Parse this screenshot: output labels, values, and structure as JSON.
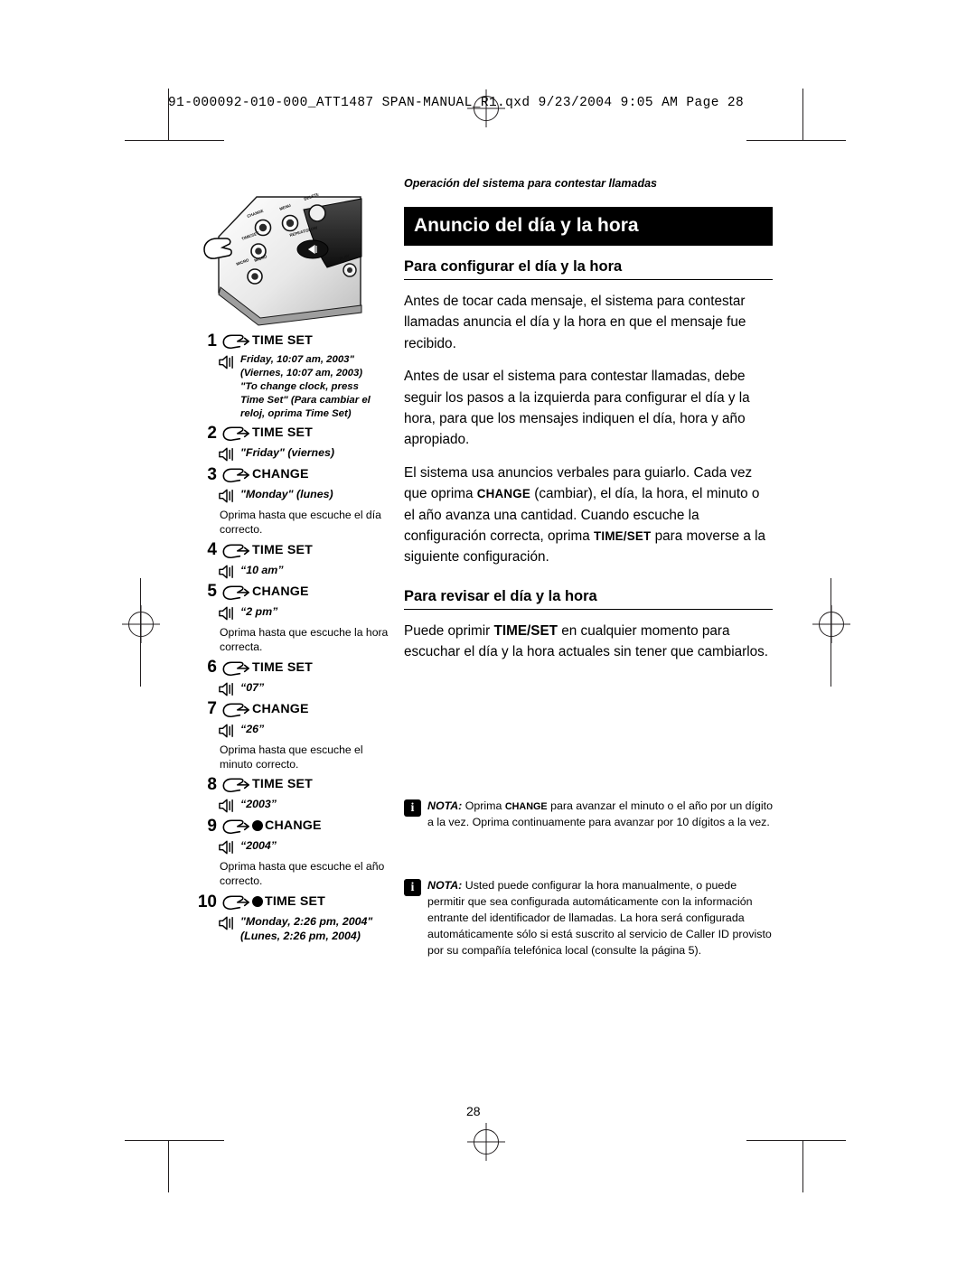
{
  "file_header": "91-000092-010-000_ATT1487 SPAN-MANUAL_R1.qxd  9/23/2004  9:05 AM  Page  28",
  "running_head": "Operación del sistema para contestar llamadas",
  "title": "Anuncio del día y la hora",
  "page_number": "28",
  "sections": [
    {
      "heading": "Para configurar el día y la hora",
      "paragraphs": [
        "Antes de tocar cada mensaje, el sistema para contestar llamadas anuncia el día y la hora en que el mensaje fue recibido.",
        "Antes de usar el sistema para contestar llamadas, debe seguir los pasos a la izquierda para configurar el día y la hora, para que los mensajes indiquen el día, hora y año apropiado."
      ]
    },
    {
      "heading": "Para revisar el día y la hora",
      "paragraphs": [
        "Puede oprimir TIME/SET en cualquier momento para escuchar el día y la hora actuales sin tener que cambiarlos."
      ]
    }
  ],
  "paragraph_mixed": {
    "before": "El sistema usa anuncios verbales para guiarlo. Cada vez que oprima ",
    "kw1": "CHANGE",
    "mid": " (cambiar), el día, la hora, el minuto o el año avanza una cantidad. Cuando escuche la configuración correcta, oprima ",
    "kw2": "TIME/SET",
    "after": " para moverse a la siguiente configuración."
  },
  "review_mixed": {
    "before": "Puede oprimir ",
    "kw": "TIME/SET",
    "after": " en cualquier momento para escuchar el día y la hora actuales sin tener que cambiarlos."
  },
  "notes": [
    {
      "icon": "i",
      "label": "NOTA:",
      "pre": " Oprima ",
      "sc": "CHANGE",
      "text": " para avanzar el minuto o el año por un dígito a la vez. Oprima continuamente para avanzar por 10 dígitos a la vez."
    },
    {
      "icon": "i",
      "label": "NOTA:",
      "pre": "",
      "sc": "",
      "text": " Usted puede configurar la hora manualmente, o puede permitir que sea configurada automáticamente con la información entrante del identificador de llamadas. La hora será configurada automáticamente sólo si está suscrito al servicio de Caller ID provisto por su compañía telefónica local (consulte la página 5)."
    }
  ],
  "device_labels": {
    "menu": "MENU",
    "change": "CHANGE",
    "timeset": "TIME/SET",
    "repeat_slow": "REPEAT/SLOW",
    "delete": "DELETE",
    "micro": "MICRO",
    "play": "PLAY"
  },
  "steps": [
    {
      "num": "1",
      "button": "TIME SET",
      "dot": false,
      "speech": "Friday, 10:07 am, 2003\"\n(Viernes, 10:07 am, 2003)\n\"To change clock, press Time Set\" (Para cambiar el reloj, oprima Time Set)",
      "speech_lines": [
        "Friday, 10:07 am, 2003\"",
        "(Viernes, 10:07 am, 2003)",
        "\"To change clock, press",
        "Time Set\" (Para cambiar el",
        "reloj, oprima Time Set)"
      ],
      "small": true,
      "hint": ""
    },
    {
      "num": "2",
      "button": "TIME SET",
      "dot": false,
      "speech_lines": [
        "\"Friday\" (viernes)"
      ],
      "small": false,
      "hint": ""
    },
    {
      "num": "3",
      "button": "CHANGE",
      "dot": false,
      "speech_lines": [
        "\"Monday\" (lunes)"
      ],
      "small": false,
      "hint": "Oprima hasta que escuche el día correcto."
    },
    {
      "num": "4",
      "button": "TIME SET",
      "dot": false,
      "speech_lines": [
        "“10 am”"
      ],
      "small": false,
      "hint": ""
    },
    {
      "num": "5",
      "button": "CHANGE",
      "dot": false,
      "speech_lines": [
        "“2 pm”"
      ],
      "small": false,
      "hint": "Oprima hasta que escuche la hora correcta."
    },
    {
      "num": "6",
      "button": "TIME SET",
      "dot": false,
      "speech_lines": [
        "“07”"
      ],
      "small": false,
      "hint": ""
    },
    {
      "num": "7",
      "button": "CHANGE",
      "dot": false,
      "speech_lines": [
        "“26”"
      ],
      "small": false,
      "hint": "Oprima hasta que escuche el minuto correcto."
    },
    {
      "num": "8",
      "button": "TIME SET",
      "dot": false,
      "speech_lines": [
        "“2003”"
      ],
      "small": false,
      "hint": ""
    },
    {
      "num": "9",
      "button": "CHANGE",
      "dot": true,
      "speech_lines": [
        "“2004”"
      ],
      "small": false,
      "hint": "Oprima hasta que escuche el año correcto."
    },
    {
      "num": "10",
      "button": "TIME SET",
      "dot": true,
      "speech_lines": [
        "\"Monday, 2:26 pm, 2004\"",
        "(Lunes, 2:26 pm, 2004)"
      ],
      "small": false,
      "hint": ""
    }
  ]
}
